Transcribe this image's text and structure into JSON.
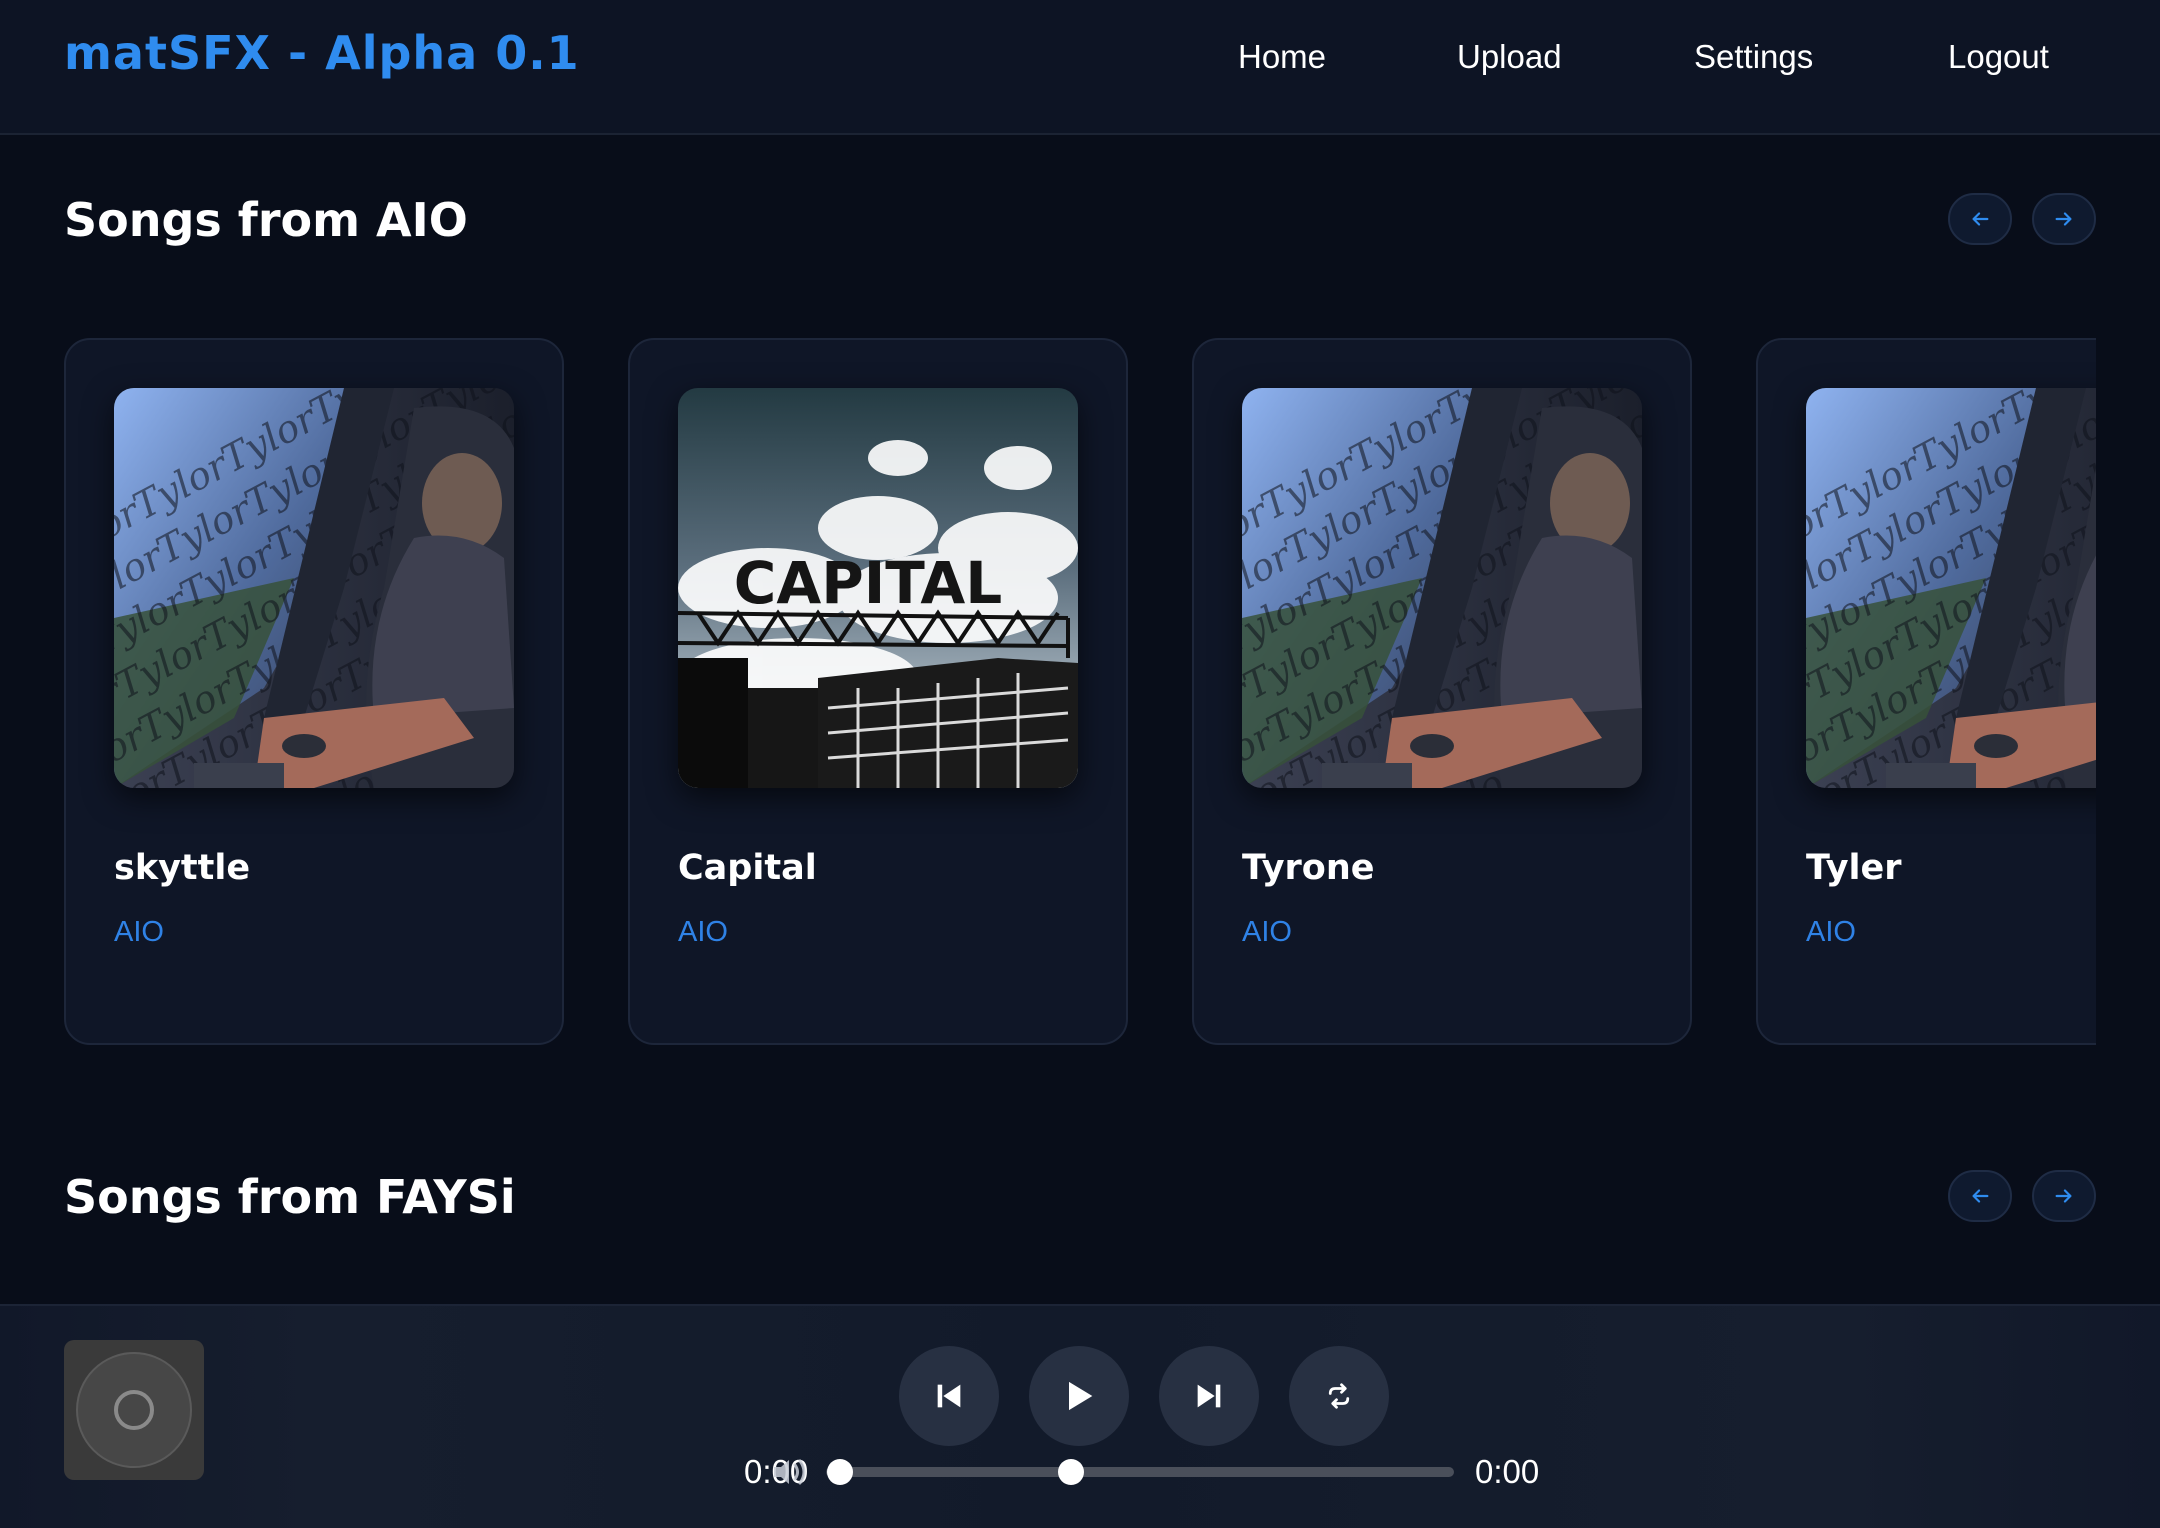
{
  "header": {
    "logo": "matSFX - Alpha 0.1",
    "nav": [
      {
        "label": "Home"
      },
      {
        "label": "Upload"
      },
      {
        "label": "Settings"
      },
      {
        "label": "Logout"
      }
    ]
  },
  "sections": [
    {
      "title": "Songs from AIO",
      "songs": [
        {
          "title": "skyttle",
          "artist": "AIO",
          "cover": "tylor-train"
        },
        {
          "title": "Capital",
          "artist": "AIO",
          "cover": "capital"
        },
        {
          "title": "Tyrone",
          "artist": "AIO",
          "cover": "tylor-train"
        },
        {
          "title": "Tyler",
          "artist": "AIO",
          "cover": "tylor-train"
        }
      ]
    },
    {
      "title": "Songs from FAYSi",
      "songs": []
    }
  ],
  "icons": {
    "prev_arrow": "arrow-left-icon",
    "next_arrow": "arrow-right-icon",
    "previous_track": "skip-back-icon",
    "play": "play-icon",
    "next_track": "skip-forward-icon",
    "repeat": "repeat-icon",
    "volume": "volume-icon",
    "disc": "disc-icon"
  },
  "player": {
    "current_time": "0:00",
    "duration": "0:00",
    "progress_fraction": 0,
    "volume_fraction": 0.5
  },
  "colors": {
    "accent": "#2f8cef",
    "background": "#080d19",
    "card": "#0f1627"
  },
  "cover_art": {
    "tylor_text": "TylorTylorTylorTylor",
    "capital_text": "CAPITAL"
  }
}
